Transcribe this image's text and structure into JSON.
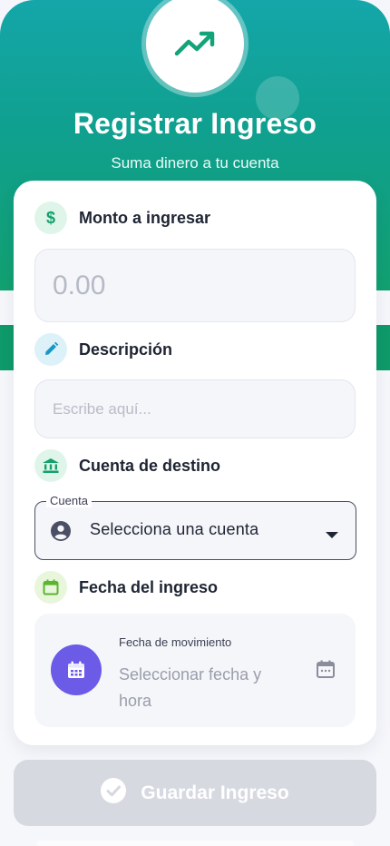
{
  "header": {
    "title": "Registrar Ingreso",
    "subtitle": "Suma dinero a tu cuenta",
    "icon": "trending-up-icon"
  },
  "form": {
    "amount": {
      "label": "Monto a ingresar",
      "placeholder": "0.00",
      "icon": "dollar-icon"
    },
    "description": {
      "label": "Descripción",
      "placeholder": "Escribe aquí...",
      "icon": "pencil-icon"
    },
    "account": {
      "label": "Cuenta de destino",
      "field_label": "Cuenta",
      "placeholder": "Selecciona una cuenta",
      "icon": "bank-icon"
    },
    "date": {
      "label": "Fecha del ingreso",
      "caption": "Fecha de movimiento",
      "placeholder": "Seleccionar fecha y hora",
      "icon": "calendar-icon"
    }
  },
  "actions": {
    "save_label": "Guardar Ingreso"
  },
  "colors": {
    "brand_teal": "#14a6a9",
    "brand_green": "#12a070",
    "accent_purple": "#6b5be6",
    "disabled_button": "#d7d9e1"
  }
}
